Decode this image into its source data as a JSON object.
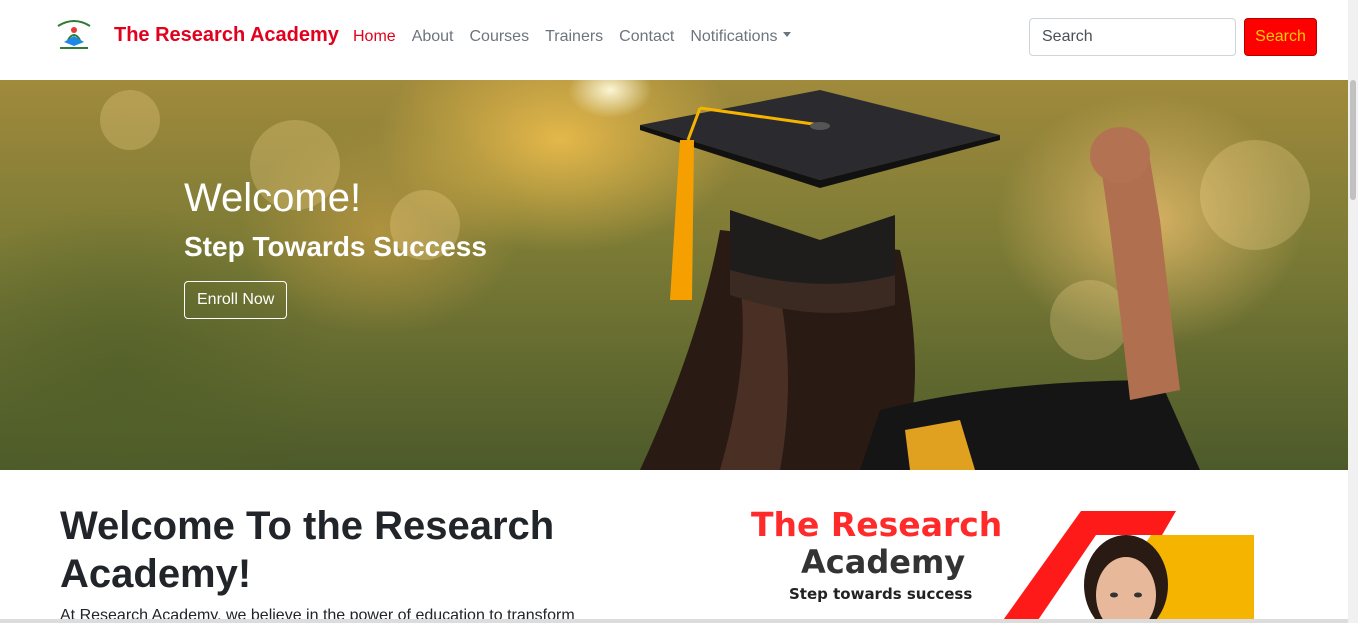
{
  "navbar": {
    "brand": "The Research Academy",
    "logo_icon": "academy-logo-icon",
    "links": [
      {
        "label": "Home",
        "active": true
      },
      {
        "label": "About"
      },
      {
        "label": "Courses"
      },
      {
        "label": "Trainers"
      },
      {
        "label": "Contact"
      },
      {
        "label": "Notifications",
        "dropdown": true
      }
    ],
    "search_placeholder": "Search",
    "search_button": "Search",
    "brand_color": "#e1001d",
    "search_button_color": "#ff0000",
    "search_button_text_color": "#ffcc00"
  },
  "hero": {
    "title": "Welcome!",
    "subtitle": "Step Towards Success",
    "button": "Enroll Now"
  },
  "about": {
    "title": "Welcome To the Research Academy!",
    "text": "At Research Academy, we believe in the power of education to transform"
  },
  "banner": {
    "line1": "The Research",
    "line2": "Academy",
    "line3": "Step towards success",
    "line1_color": "#ff2a2a",
    "line2_color": "#333333",
    "accent_colors": [
      "#ff0000",
      "#f5b400"
    ]
  }
}
